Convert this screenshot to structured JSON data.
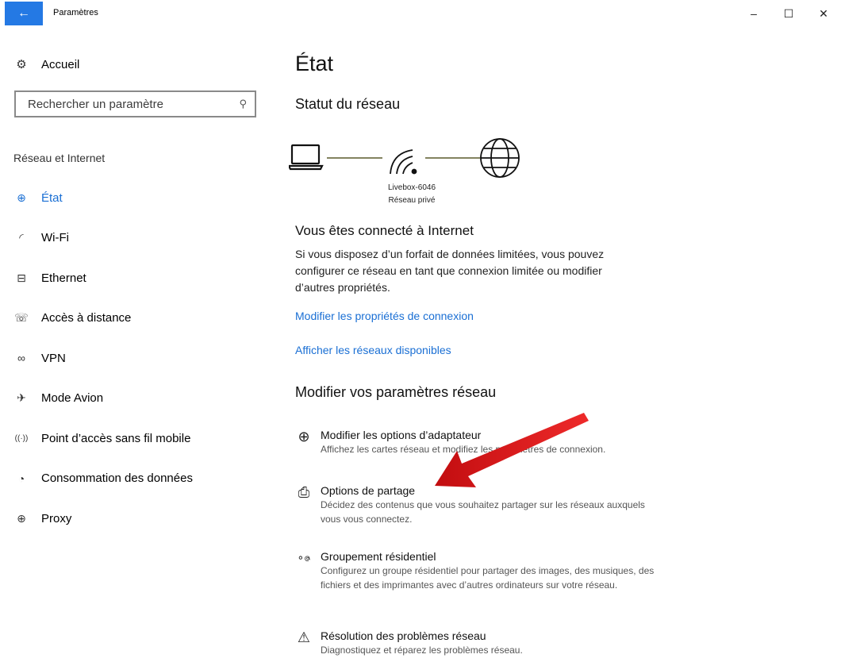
{
  "window": {
    "title": "Paramètres",
    "back_glyph": "←",
    "minimize_glyph": "–",
    "maximize_glyph": "☐",
    "close_glyph": "✕"
  },
  "sidebar": {
    "home_label": "Accueil",
    "home_icon": "gear-icon",
    "search_placeholder": "Rechercher un paramètre",
    "section_title": "Réseau et Internet",
    "items": [
      {
        "label": "État",
        "icon": "globe-status-icon",
        "glyph": "⊕",
        "active": true
      },
      {
        "label": "Wi-Fi",
        "icon": "wifi-icon",
        "glyph": "◜",
        "active": false
      },
      {
        "label": "Ethernet",
        "icon": "ethernet-icon",
        "glyph": "⊟",
        "active": false
      },
      {
        "label": "Accès à distance",
        "icon": "dial-up-icon",
        "glyph": "☏",
        "active": false
      },
      {
        "label": "VPN",
        "icon": "vpn-icon",
        "glyph": "∞",
        "active": false
      },
      {
        "label": "Mode Avion",
        "icon": "airplane-icon",
        "glyph": "✈",
        "active": false
      },
      {
        "label": "Point d’accès sans fil mobile",
        "icon": "hotspot-icon",
        "glyph": "((·))",
        "active": false
      },
      {
        "label": "Consommation des données",
        "icon": "data-usage-icon",
        "glyph": "◔",
        "active": false
      },
      {
        "label": "Proxy",
        "icon": "globe-icon",
        "glyph": "⊕",
        "active": false
      }
    ]
  },
  "main": {
    "page_title": "État",
    "network_status_title": "Statut du réseau",
    "network_name": "Livebox-6046",
    "network_type": "Réseau privé",
    "connected_title": "Vous êtes connecté à Internet",
    "connected_desc": "Si vous disposez d’un forfait de données limitées, vous pouvez configurer ce réseau en tant que connexion limitée ou modifier d’autres propriétés.",
    "link_properties": "Modifier les propriétés de connexion",
    "link_networks": "Afficher les réseaux disponibles",
    "modify_title": "Modifier vos paramètres réseau",
    "options": [
      {
        "title": "Modifier les options d’adaptateur",
        "desc": "Affichez les cartes réseau et modifiez les paramètres de connexion.",
        "icon": "adapter-icon",
        "glyph": "⊕"
      },
      {
        "title": "Options de partage",
        "desc": "Décidez des contenus que vous souhaitez partager sur les réseaux auxquels vous vous connectez.",
        "icon": "sharing-icon",
        "glyph": "⎙"
      },
      {
        "title": "Groupement résidentiel",
        "desc": "Configurez un groupe résidentiel pour partager des images, des musiques, des fichiers et des imprimantes avec d’autres ordinateurs sur votre réseau.",
        "icon": "homegroup-icon",
        "glyph": "∘ဇ"
      },
      {
        "title": "Résolution des problèmes réseau",
        "desc": "Diagnostiquez et réparez les problèmes réseau.",
        "icon": "warning-icon",
        "glyph": "⚠"
      }
    ]
  },
  "colors": {
    "accent": "#1a6fd4",
    "back_button": "#2479e4",
    "annotation_arrow": "#e3171b"
  }
}
